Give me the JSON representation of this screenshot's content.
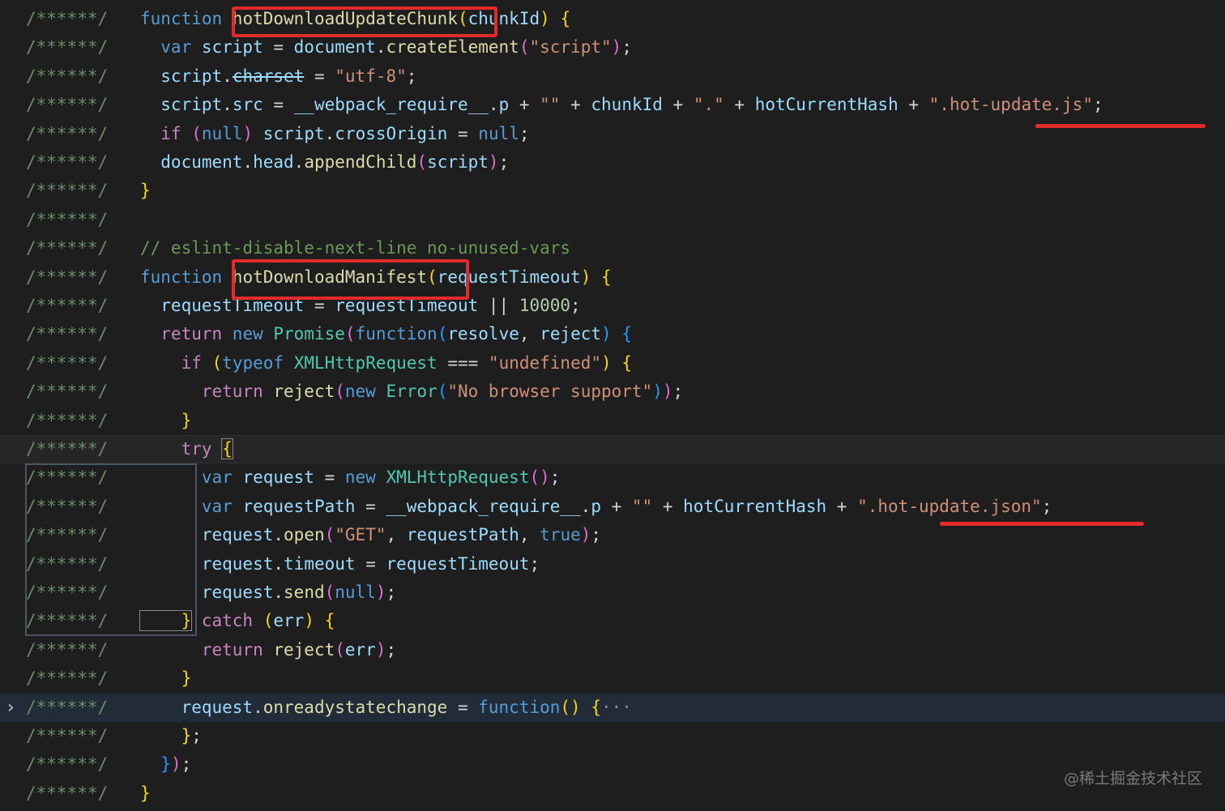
{
  "gutter_text": "/******/",
  "watermark": "@稀土掘金技术社区",
  "lines": [
    [
      [
        "kw",
        "function "
      ],
      [
        "fn",
        "hotDownloadUpdateChunk"
      ],
      [
        "b1",
        "("
      ],
      [
        "var",
        "chunkId"
      ],
      [
        "b1",
        ")"
      ],
      [
        "pun",
        " "
      ],
      [
        "b1",
        "{"
      ]
    ],
    [
      [
        "kw",
        "  var "
      ],
      [
        "var",
        "script"
      ],
      [
        "pun",
        " = "
      ],
      [
        "var",
        "document"
      ],
      [
        "pun",
        "."
      ],
      [
        "fn",
        "createElement"
      ],
      [
        "b2",
        "("
      ],
      [
        "str",
        "\"script\""
      ],
      [
        "b2",
        ")"
      ],
      [
        "pun",
        ";"
      ]
    ],
    [
      [
        "var",
        "  script"
      ],
      [
        "pun",
        "."
      ],
      [
        "var",
        "charset",
        "strike"
      ],
      [
        "pun",
        " = "
      ],
      [
        "str",
        "\"utf-8\""
      ],
      [
        "pun",
        ";"
      ]
    ],
    [
      [
        "var",
        "  script"
      ],
      [
        "pun",
        "."
      ],
      [
        "var",
        "src"
      ],
      [
        "pun",
        " = "
      ],
      [
        "var",
        "__webpack_require__"
      ],
      [
        "pun",
        "."
      ],
      [
        "var",
        "p"
      ],
      [
        "pun",
        " + "
      ],
      [
        "str",
        "\"\""
      ],
      [
        "pun",
        " + "
      ],
      [
        "var",
        "chunkId"
      ],
      [
        "pun",
        " + "
      ],
      [
        "str",
        "\".\""
      ],
      [
        "pun",
        " + "
      ],
      [
        "var",
        "hotCurrentHash"
      ],
      [
        "pun",
        " + "
      ],
      [
        "str",
        "\".hot-update.js\""
      ],
      [
        "pun",
        ";"
      ]
    ],
    [
      [
        "ctl",
        "  if "
      ],
      [
        "b2",
        "("
      ],
      [
        "kw",
        "null"
      ],
      [
        "b2",
        ")"
      ],
      [
        "pun",
        " "
      ],
      [
        "var",
        "script"
      ],
      [
        "pun",
        "."
      ],
      [
        "var",
        "crossOrigin"
      ],
      [
        "pun",
        " = "
      ],
      [
        "kw",
        "null"
      ],
      [
        "pun",
        ";"
      ]
    ],
    [
      [
        "var",
        "  document"
      ],
      [
        "pun",
        "."
      ],
      [
        "var",
        "head"
      ],
      [
        "pun",
        "."
      ],
      [
        "fn",
        "appendChild"
      ],
      [
        "b2",
        "("
      ],
      [
        "var",
        "script"
      ],
      [
        "b2",
        ")"
      ],
      [
        "pun",
        ";"
      ]
    ],
    [
      [
        "b1",
        "}"
      ]
    ],
    [],
    [
      [
        "cm",
        "// eslint-disable-next-line no-unused-vars"
      ]
    ],
    [
      [
        "kw",
        "function "
      ],
      [
        "fn",
        "hotDownloadManifest"
      ],
      [
        "b1",
        "("
      ],
      [
        "var",
        "requestTimeout"
      ],
      [
        "b1",
        ")"
      ],
      [
        "pun",
        " "
      ],
      [
        "b1",
        "{"
      ]
    ],
    [
      [
        "var",
        "  requestTimeout"
      ],
      [
        "pun",
        " = "
      ],
      [
        "var",
        "requestTimeout"
      ],
      [
        "pun",
        " || "
      ],
      [
        "num",
        "10000"
      ],
      [
        "pun",
        ";"
      ]
    ],
    [
      [
        "ctl",
        "  return "
      ],
      [
        "kw",
        "new "
      ],
      [
        "cls",
        "Promise"
      ],
      [
        "b2",
        "("
      ],
      [
        "kw",
        "function"
      ],
      [
        "b3",
        "("
      ],
      [
        "var",
        "resolve"
      ],
      [
        "pun",
        ", "
      ],
      [
        "var",
        "reject"
      ],
      [
        "b3",
        ")"
      ],
      [
        "pun",
        " "
      ],
      [
        "b3",
        "{"
      ]
    ],
    [
      [
        "ctl",
        "    if "
      ],
      [
        "b1",
        "("
      ],
      [
        "kw",
        "typeof "
      ],
      [
        "cls",
        "XMLHttpRequest"
      ],
      [
        "pun",
        " === "
      ],
      [
        "str",
        "\"undefined\""
      ],
      [
        "b1",
        ")"
      ],
      [
        "pun",
        " "
      ],
      [
        "b1",
        "{"
      ]
    ],
    [
      [
        "ctl",
        "      return "
      ],
      [
        "fn",
        "reject"
      ],
      [
        "b2",
        "("
      ],
      [
        "kw",
        "new "
      ],
      [
        "cls",
        "Error"
      ],
      [
        "b3",
        "("
      ],
      [
        "str",
        "\"No browser support\""
      ],
      [
        "b3",
        ")"
      ],
      [
        "b2",
        ")"
      ],
      [
        "pun",
        ";"
      ]
    ],
    [
      [
        "b1",
        "    }"
      ]
    ],
    [
      [
        "ctl",
        "    try "
      ],
      [
        "b1",
        "{",
        "cursor-bracket"
      ]
    ],
    [
      [
        "kw",
        "      var "
      ],
      [
        "var",
        "request"
      ],
      [
        "pun",
        " = "
      ],
      [
        "kw",
        "new "
      ],
      [
        "cls",
        "XMLHttpRequest"
      ],
      [
        "b2",
        "()"
      ],
      [
        "pun",
        ";"
      ]
    ],
    [
      [
        "kw",
        "      var "
      ],
      [
        "var",
        "requestPath"
      ],
      [
        "pun",
        " = "
      ],
      [
        "var",
        "__webpack_require__"
      ],
      [
        "pun",
        "."
      ],
      [
        "var",
        "p"
      ],
      [
        "pun",
        " + "
      ],
      [
        "str",
        "\"\""
      ],
      [
        "pun",
        " + "
      ],
      [
        "var",
        "hotCurrentHash"
      ],
      [
        "pun",
        " + "
      ],
      [
        "str",
        "\".hot-update.json\""
      ],
      [
        "pun",
        ";"
      ]
    ],
    [
      [
        "var",
        "      request"
      ],
      [
        "pun",
        "."
      ],
      [
        "fn",
        "open"
      ],
      [
        "b2",
        "("
      ],
      [
        "str",
        "\"GET\""
      ],
      [
        "pun",
        ", "
      ],
      [
        "var",
        "requestPath"
      ],
      [
        "pun",
        ", "
      ],
      [
        "kw",
        "true"
      ],
      [
        "b2",
        ")"
      ],
      [
        "pun",
        ";"
      ]
    ],
    [
      [
        "var",
        "      request"
      ],
      [
        "pun",
        "."
      ],
      [
        "var",
        "timeout"
      ],
      [
        "pun",
        " = "
      ],
      [
        "var",
        "requestTimeout"
      ],
      [
        "pun",
        ";"
      ]
    ],
    [
      [
        "var",
        "      request"
      ],
      [
        "pun",
        "."
      ],
      [
        "fn",
        "send"
      ],
      [
        "b2",
        "("
      ],
      [
        "kw",
        "null"
      ],
      [
        "b2",
        ")"
      ],
      [
        "pun",
        ";"
      ]
    ],
    [
      [
        "b1",
        "    }",
        "cursor-bracket"
      ],
      [
        "ctl",
        " catch "
      ],
      [
        "b1",
        "("
      ],
      [
        "var",
        "err"
      ],
      [
        "b1",
        ")"
      ],
      [
        "pun",
        " "
      ],
      [
        "b1",
        "{"
      ]
    ],
    [
      [
        "ctl",
        "      return "
      ],
      [
        "fn",
        "reject"
      ],
      [
        "b2",
        "("
      ],
      [
        "var",
        "err"
      ],
      [
        "b2",
        ")"
      ],
      [
        "pun",
        ";"
      ]
    ],
    [
      [
        "b1",
        "    }"
      ]
    ],
    [
      [
        "var",
        "    request"
      ],
      [
        "pun",
        "."
      ],
      [
        "fn",
        "onreadystatechange"
      ],
      [
        "pun",
        " = "
      ],
      [
        "kw",
        "function"
      ],
      [
        "b1",
        "()"
      ],
      [
        "pun",
        " "
      ],
      [
        "b1",
        "{"
      ],
      [
        "ellipsis",
        "···"
      ]
    ],
    [
      [
        "b1",
        "    }"
      ],
      [
        "pun",
        ";"
      ]
    ],
    [
      [
        "b3",
        "  }"
      ],
      [
        "b2",
        ")"
      ],
      [
        "pun",
        ";"
      ]
    ],
    [
      [
        "b1",
        "}"
      ]
    ]
  ],
  "annotations": {
    "highlighted_functions": [
      "hotDownloadUpdateChunk",
      "hotDownloadManifest"
    ],
    "underlined_strings": [
      "\".hot-update.js\"",
      "\".hot-update.json\""
    ],
    "annotation_color": "#e32b2b"
  },
  "colors": {
    "background": "#1e1e1e",
    "keyword": "#569cd6",
    "function": "#dcdcaa",
    "variable": "#9cdcfe",
    "string": "#ce9178",
    "comment": "#6a9955"
  }
}
